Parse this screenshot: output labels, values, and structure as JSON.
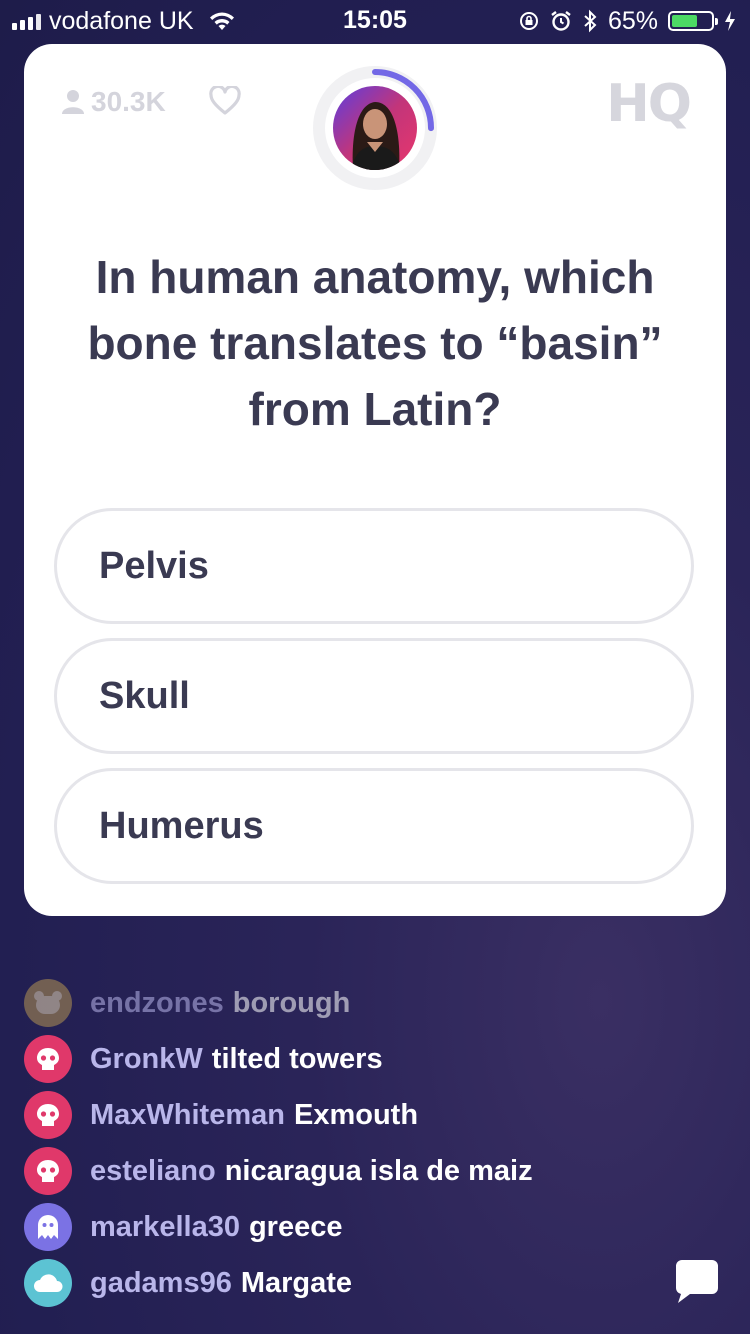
{
  "status_bar": {
    "carrier": "vodafone UK",
    "time": "15:05",
    "battery_percent": "65%",
    "battery_level": 0.65,
    "icons": [
      "signal-icon",
      "wifi-icon",
      "rotation-lock-icon",
      "alarm-icon",
      "bluetooth-icon",
      "battery-icon",
      "charging-icon"
    ]
  },
  "card": {
    "viewer_count": "30.3K",
    "logo": "HQ",
    "timer_progress": 0.25,
    "question": "In human anatomy, which bone translates to “basin” from Latin?",
    "answers": [
      {
        "label": "Pelvis"
      },
      {
        "label": "Skull"
      },
      {
        "label": "Humerus"
      }
    ]
  },
  "chat": {
    "messages": [
      {
        "user": "endzones",
        "message": "borough",
        "avatar_color": "#b39452",
        "faded": true
      },
      {
        "user": "GronkW",
        "message": "tilted towers",
        "avatar_color": "#e0386a",
        "faded": false
      },
      {
        "user": "MaxWhiteman",
        "message": "Exmouth",
        "avatar_color": "#e0386a",
        "faded": false
      },
      {
        "user": "esteliano",
        "message": "nicaragua isla de maiz",
        "avatar_color": "#e0386a",
        "faded": false
      },
      {
        "user": "markella30",
        "message": "greece",
        "avatar_color": "#7b72e4",
        "faded": false
      },
      {
        "user": "gadams96",
        "message": "Margate",
        "avatar_color": "#5cc3d3",
        "faded": false
      }
    ]
  },
  "colors": {
    "background": "#221f52",
    "card": "#ffffff",
    "question_text": "#3a3a52",
    "timer_accent": "#7368e6",
    "chat_username": "#b9b6ea"
  }
}
